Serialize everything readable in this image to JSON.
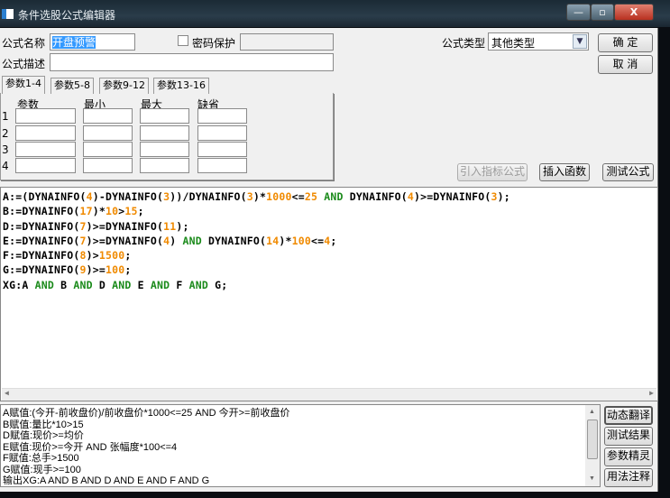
{
  "window": {
    "title": "条件选股公式编辑器",
    "minimize": "—",
    "maximize": "▫",
    "close": "X"
  },
  "form": {
    "name_label": "公式名称",
    "name_value": "开盘预警",
    "password_label": "密码保护",
    "password_checked": false,
    "password_value": "",
    "type_label": "公式类型",
    "type_value": "其他类型",
    "desc_label": "公式描述",
    "desc_value": "",
    "ok": "确  定",
    "cancel": "取  消"
  },
  "tabs": [
    {
      "label": "参数1-4",
      "active": true
    },
    {
      "label": "参数5-8"
    },
    {
      "label": "参数9-12"
    },
    {
      "label": "参数13-16"
    }
  ],
  "params": {
    "headers": [
      "参数",
      "最小",
      "最大",
      "缺省"
    ],
    "rows": [
      "1",
      "2",
      "3",
      "4"
    ]
  },
  "actions": {
    "import": "引入指标公式",
    "insert": "插入函数",
    "test": "测试公式"
  },
  "code": [
    "A:=(DYNAINFO(4)-DYNAINFO(3))/DYNAINFO(3)*1000<=25 AND DYNAINFO(4)>=DYNAINFO(3);",
    "B:=DYNAINFO(17)*10>15;",
    "D:=DYNAINFO(7)>=DYNAINFO(11);",
    "E:=DYNAINFO(7)>=DYNAINFO(4) AND DYNAINFO(14)*100<=4;",
    "F:=DYNAINFO(8)>1500;",
    "G:=DYNAINFO(9)>=100;",
    "XG:A AND B AND D AND E AND F AND G;"
  ],
  "translation": [
    "A赋值:(今开-前收盘价)/前收盘价*1000<=25 AND 今开>=前收盘价",
    "B赋值:量比*10>15",
    "D赋值:现价>=均价",
    "E赋值:现价>=今开 AND 张幅度*100<=4",
    "F赋值:总手>1500",
    "G赋值:现手>=100",
    "输出XG:A AND B AND D AND E AND F AND G"
  ],
  "side_buttons": [
    "动态翻译",
    "测试结果",
    "参数精灵",
    "用法注释"
  ],
  "colors": {
    "number": "#f08a00",
    "keyword": "#1a8a1a",
    "selection": "#3399ff"
  }
}
